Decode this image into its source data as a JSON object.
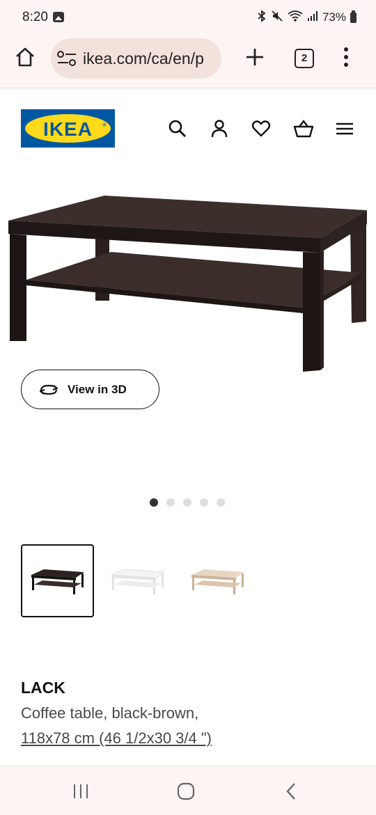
{
  "status_bar": {
    "time": "8:20",
    "battery": "73%",
    "icons": [
      "gallery-icon",
      "bluetooth-icon",
      "mute-icon",
      "wifi-icon",
      "signal-icon",
      "battery-icon"
    ]
  },
  "browser": {
    "url": "ikea.com/ca/en/p",
    "tab_count": "2",
    "theme_color": "#fdf5f3"
  },
  "header": {
    "logo_text": "IKEA",
    "logo_colors": {
      "blue": "#0058a3",
      "yellow": "#ffda1a"
    },
    "icons": [
      "search-icon",
      "account-icon",
      "heart-icon",
      "basket-icon",
      "hamburger-icon"
    ]
  },
  "product": {
    "view_3d_label": "View in 3D",
    "image_count": 5,
    "active_image": 1,
    "variants": [
      "black-brown",
      "white",
      "white stained oak effect"
    ],
    "selected_variant": 0,
    "name": "LACK",
    "description": "Coffee table, black-brown,",
    "size": "118x78 cm (46 1/2x30 3/4 \")"
  },
  "nav": {
    "icons": [
      "recent-apps-icon",
      "home-icon",
      "back-icon"
    ]
  }
}
